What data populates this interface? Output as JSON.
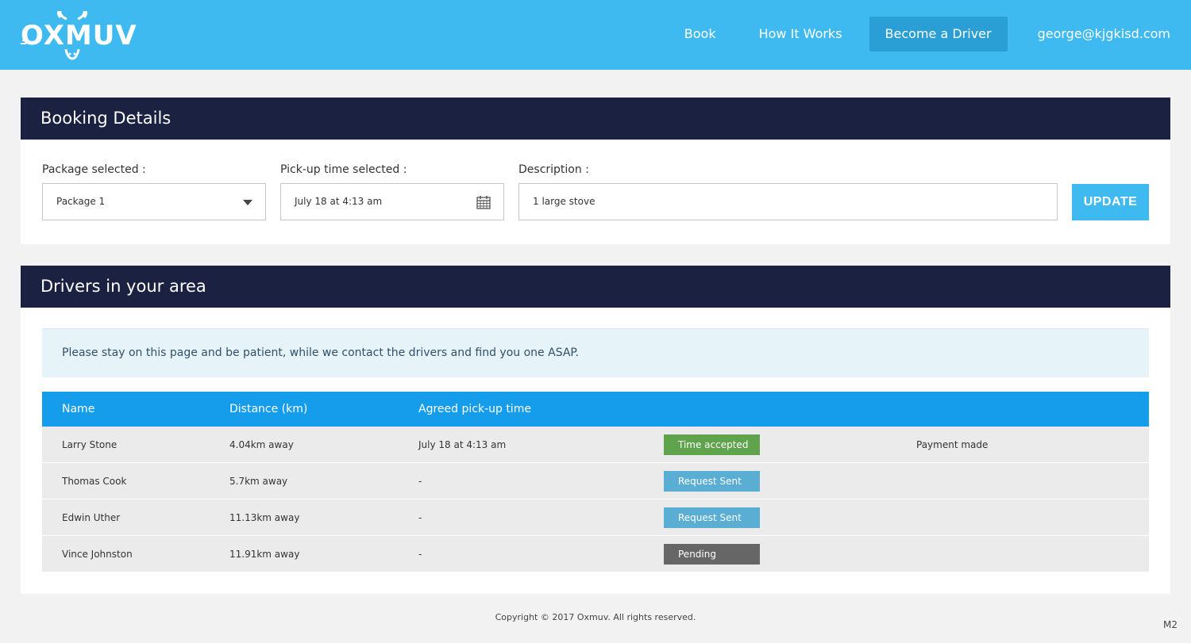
{
  "brand": {
    "name": "OXMUV",
    "color": "#3fbaf0",
    "icon": "bull-horns-logo-icon"
  },
  "nav": {
    "book": "Book",
    "how_it_works": "How It Works",
    "become_driver": "Become a Driver",
    "user": "george@kjgkisd.com"
  },
  "booking": {
    "title": "Booking Details",
    "package_label": "Package selected :",
    "package_value": "Package 1",
    "pickup_label": "Pick-up time selected :",
    "pickup_value": "July 18 at 4:13 am",
    "description_label": "Description :",
    "description_value": "1 large stove",
    "update_label": "UPDATE"
  },
  "drivers": {
    "title": "Drivers in your area",
    "notice": "Please stay on this page and be patient, while we contact the drivers and find you one ASAP.",
    "columns": [
      "Name",
      "Distance (km)",
      "Agreed pick-up time"
    ],
    "rows": [
      {
        "name": "Larry Stone",
        "distance": "4.04km away",
        "time": "July 18 at 4:13 am",
        "status": "Time accepted",
        "status_color": "#5fa34c",
        "payment": "Payment made"
      },
      {
        "name": "Thomas Cook",
        "distance": "5.7km away",
        "time": "-",
        "status": "Request Sent",
        "status_color": "#5aaed4",
        "payment": ""
      },
      {
        "name": "Edwin Uther",
        "distance": "11.13km away",
        "time": "-",
        "status": "Request Sent",
        "status_color": "#5aaed4",
        "payment": ""
      },
      {
        "name": "Vince Johnston",
        "distance": "11.91km away",
        "time": "-",
        "status": "Pending",
        "status_color": "#666666",
        "payment": ""
      }
    ]
  },
  "footer": {
    "copyright": "Copyright  ©  2017  Oxmuv.  All rights reserved.",
    "version": "M2"
  }
}
